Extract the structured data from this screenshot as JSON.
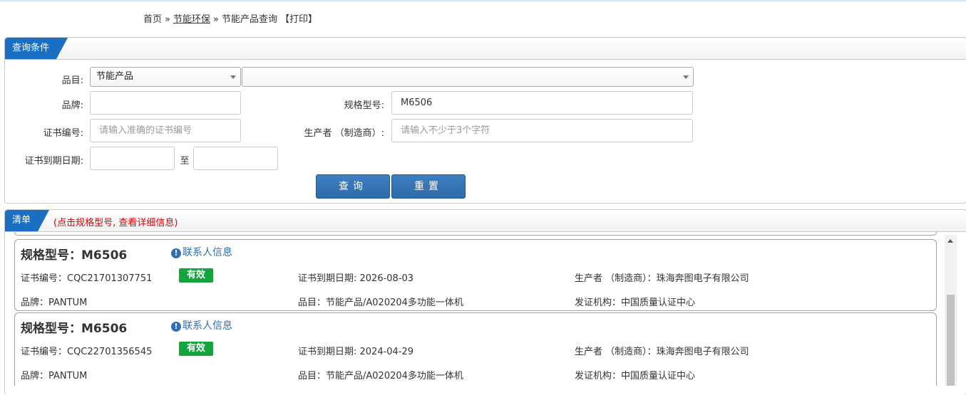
{
  "breadcrumb": {
    "home": "首页",
    "sep": "»",
    "section": "节能环保",
    "current": "节能产品查询",
    "print": "【打印】"
  },
  "query_panel": {
    "title": "查询条件",
    "category_label": "品目:",
    "category_value": "节能产品",
    "subcategory_value": "",
    "brand_label": "品牌:",
    "brand_value": "",
    "model_label": "规格型号:",
    "model_value": "M6506",
    "cert_no_label": "证书编号:",
    "cert_no_placeholder": "请输入准确的证书编号",
    "manufacturer_label": "生产者 （制造商）:",
    "manufacturer_placeholder": "请输入不少于3个字符",
    "expiry_label": "证书到期日期:",
    "expiry_to": "至",
    "search_button": "查询",
    "reset_button": "重置"
  },
  "list_panel": {
    "title": "清单",
    "hint": "(点击规格型号, 查看详细信息)"
  },
  "contact_icon": "info-circle-icon",
  "colors": {
    "accent": "#1a6fc3",
    "valid_badge": "#14a33c",
    "hint_text": "#e00000"
  },
  "results": [
    {
      "model": "规格型号：M6506",
      "contact": "联系人信息",
      "cert_no": "证书编号：CQC21701307751",
      "status": "有效",
      "expiry": "证书到期日期: 2026-08-03",
      "manufacturer": "生产者 （制造商）：珠海奔图电子有限公司",
      "brand": "品牌：PANTUM",
      "category": "品目：节能产品/A020204多功能一体机",
      "issuer": "发证机构：中国质量认证中心"
    },
    {
      "model": "规格型号：M6506",
      "contact": "联系人信息",
      "cert_no": "证书编号：CQC22701356545",
      "status": "有效",
      "expiry": "证书到期日期: 2024-04-29",
      "manufacturer": "生产者 （制造商）：珠海奔图电子有限公司",
      "brand": "品牌：PANTUM",
      "category": "品目：节能产品/A020204多功能一体机",
      "issuer": "发证机构：中国质量认证中心"
    }
  ]
}
